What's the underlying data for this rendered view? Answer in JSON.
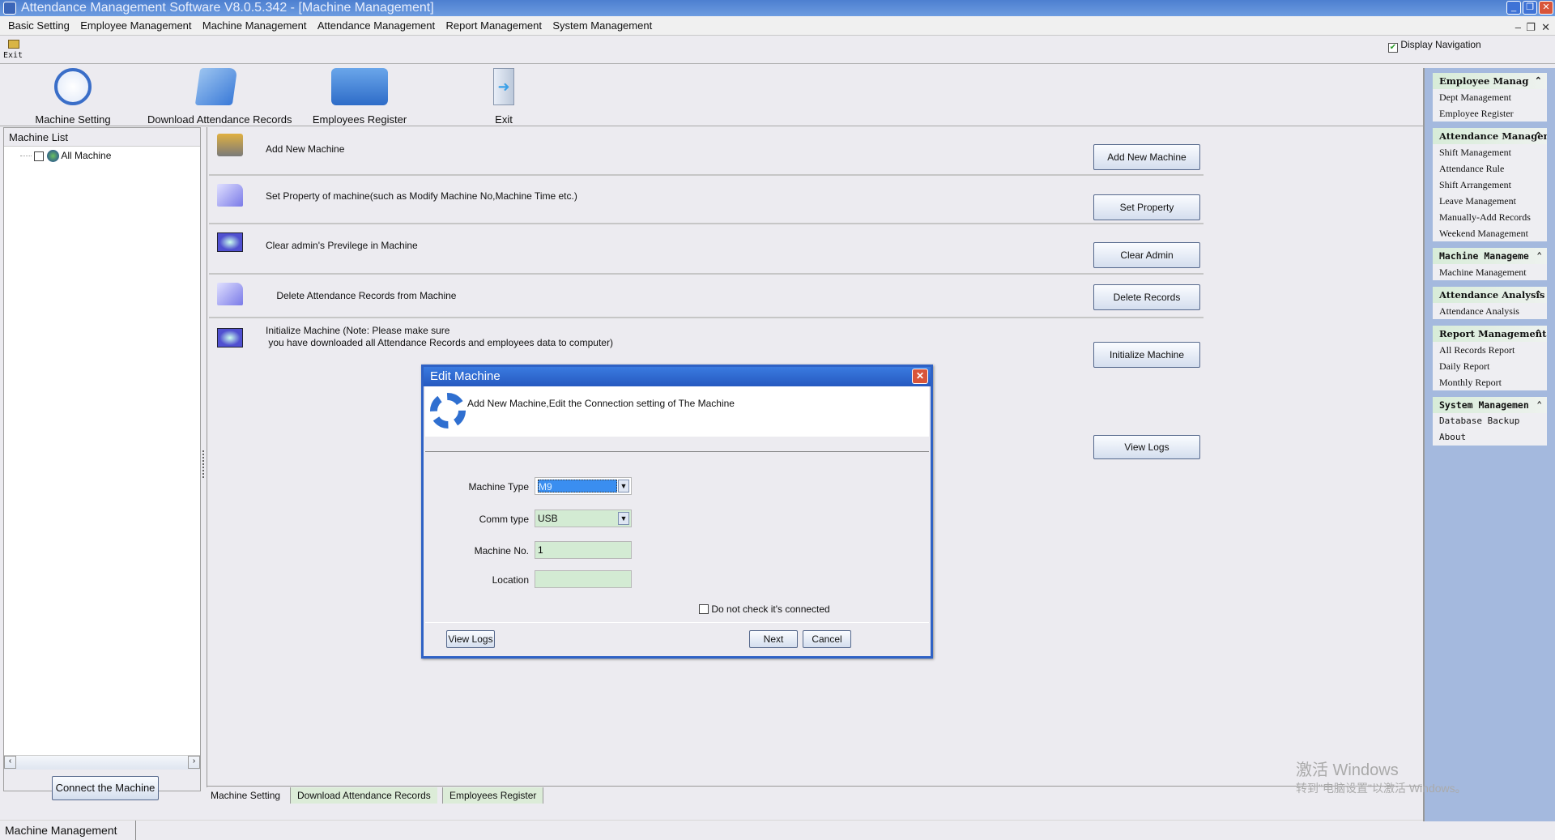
{
  "window": {
    "title": "Attendance Management Software V8.0.5.342 - [Machine Management]",
    "controls": [
      "minimize",
      "restore",
      "close"
    ]
  },
  "menu": [
    "Basic Setting",
    "Employee Management",
    "Machine Management",
    "Attendance Management",
    "Report Management",
    "System Management"
  ],
  "small_toolbar": {
    "exit_label": "Exit"
  },
  "display_navigation": {
    "label": "Display Navigation",
    "checked": true
  },
  "toolbar": [
    {
      "label": "Machine Setting",
      "icon": "clock-icon"
    },
    {
      "label": "Download Attendance Records",
      "icon": "folder-icon"
    },
    {
      "label": "Employees Register",
      "icon": "monitor-folder-icon"
    },
    {
      "label": "Exit",
      "icon": "exit-door-icon"
    }
  ],
  "machine_list": {
    "header": "Machine List",
    "root": "All Machine",
    "connect_button": "Connect the Machine"
  },
  "actions": [
    {
      "text": "Add New Machine",
      "button": "Add New Machine"
    },
    {
      "text": "Set Property of machine(such as Modify Machine No,Machine Time etc.)",
      "button": "Set Property"
    },
    {
      "text": "Clear admin's Previlege in Machine",
      "button": "Clear Admin"
    },
    {
      "text": "    Delete Attendance Records from Machine",
      "button": "Delete Records"
    },
    {
      "text": "Initialize Machine (Note: Please make sure\n you have downloaded all Attendance Records and employees data to computer)",
      "button": "Initialize Machine"
    }
  ],
  "view_logs_button": "View Logs",
  "bottom_tabs": [
    "Machine Setting",
    "Download Attendance Records",
    "Employees Register"
  ],
  "status_tab": "Machine Management",
  "nav": [
    {
      "title": "Employee Manag",
      "items": [
        "Dept Management",
        "Employee Register"
      ]
    },
    {
      "title": "Attendance Managem",
      "items": [
        "Shift Management",
        "Attendance Rule",
        "Shift Arrangement",
        "Leave Management",
        "Manually-Add Records",
        "Weekend Management"
      ]
    },
    {
      "title": "Machine Manageme",
      "items": [
        "Machine Management"
      ]
    },
    {
      "title": "Attendance Analysis",
      "items": [
        "Attendance Analysis"
      ]
    },
    {
      "title": "Report Management",
      "items": [
        "All Records Report",
        "Daily Report",
        "Monthly Report"
      ]
    },
    {
      "title": "System Managemen",
      "items": [
        "Database Backup",
        "About"
      ]
    }
  ],
  "dialog": {
    "title": "Edit Machine",
    "description": "Add New Machine,Edit the Connection setting of The Machine",
    "fields": {
      "machine_type": {
        "label": "Machine Type",
        "value": "M9"
      },
      "comm_type": {
        "label": "Comm type",
        "value": "USB"
      },
      "machine_no": {
        "label": "Machine No.",
        "value": "1"
      },
      "location": {
        "label": "Location",
        "value": ""
      }
    },
    "checkbox": {
      "label": "Do not check it's connected",
      "checked": false
    },
    "view_logs": "View Logs",
    "next": "Next",
    "cancel": "Cancel"
  },
  "watermark": {
    "line1": "激活 Windows",
    "line2": "转到\"电脑设置\"以激活 Windows。"
  },
  "colors": {
    "titlebar": "#4d7fd0",
    "nav_bg": "#a4b9de",
    "field_bg": "#d3ebd3",
    "selection": "#3a8ef0"
  }
}
